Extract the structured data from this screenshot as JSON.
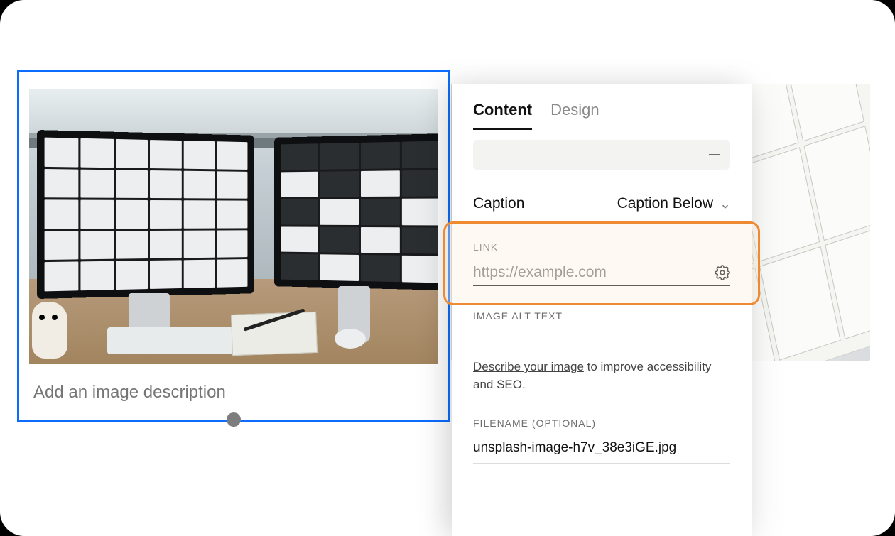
{
  "tabs": {
    "content": "Content",
    "design": "Design",
    "active": "content"
  },
  "caption": {
    "label": "Caption",
    "mode": "Caption Below"
  },
  "image_block": {
    "description_placeholder": "Add an image description"
  },
  "link_section": {
    "title": "LINK",
    "placeholder": "https://example.com"
  },
  "alt_section": {
    "title": "IMAGE ALT TEXT",
    "helper_prefix": "Describe your image",
    "helper_suffix": " to improve accessibility and SEO."
  },
  "filename_section": {
    "title": "FILENAME (OPTIONAL)",
    "value": "unsplash-image-h7v_38e3iGE.jpg"
  }
}
